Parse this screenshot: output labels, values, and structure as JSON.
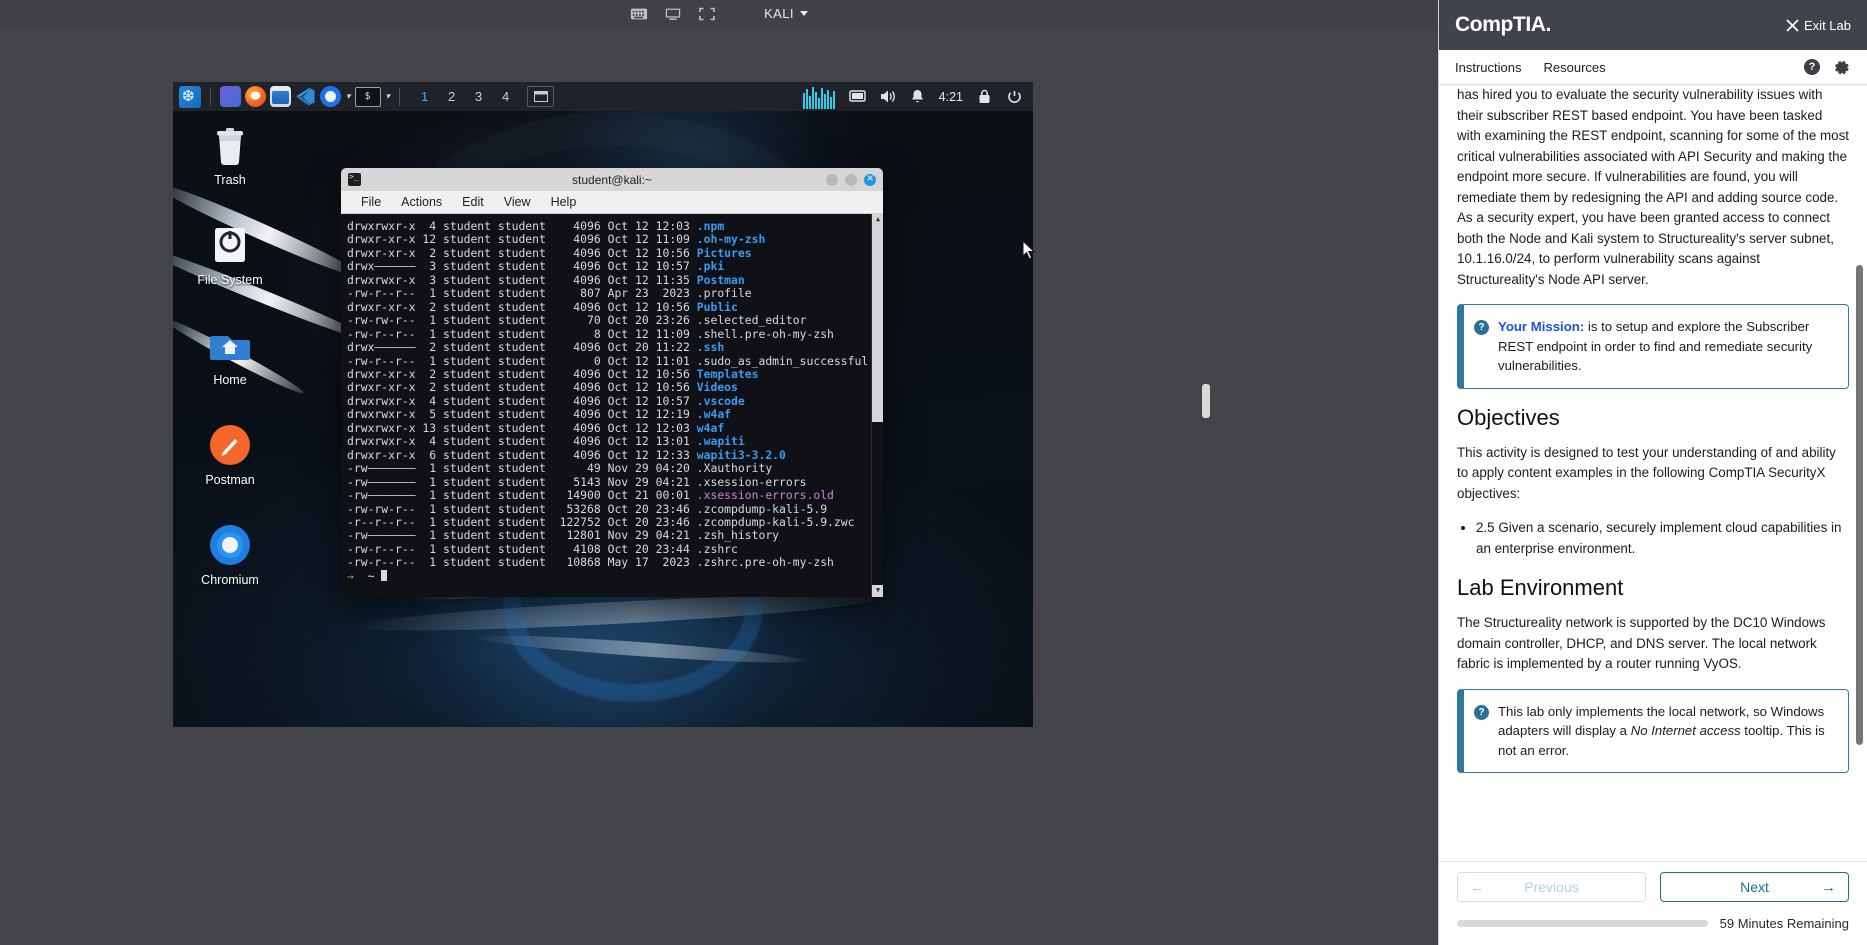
{
  "vm_topbar": {
    "icons": [
      "keyboard-icon",
      "monitor-icon",
      "fullscreen-icon"
    ],
    "vm_name": "KALI"
  },
  "kali_panel": {
    "apps": [
      "kali-menu-icon",
      "terminal-app-icon",
      "firefox-icon",
      "file-manager-icon",
      "vscode-icon",
      "chromium-icon",
      "terminal-launcher-icon"
    ],
    "workspaces": [
      "1",
      "2",
      "3",
      "4"
    ],
    "active_workspace": "1",
    "clock": "4:21",
    "tray": [
      "display-icon",
      "volume-icon",
      "notification-icon",
      "lock-icon",
      "power-icon"
    ]
  },
  "desktop_icons": [
    {
      "name": "Trash",
      "icon": "trash-icon"
    },
    {
      "name": "File System",
      "icon": "drive-icon"
    },
    {
      "name": "Home",
      "icon": "home-folder-icon"
    },
    {
      "name": "Postman",
      "icon": "postman-icon"
    },
    {
      "name": "Chromium",
      "icon": "chromium-icon"
    }
  ],
  "terminal": {
    "title": "student@kali:~",
    "menu": [
      "File",
      "Actions",
      "Edit",
      "View",
      "Help"
    ],
    "window_buttons": [
      "minimize",
      "maximize",
      "close"
    ],
    "lines": [
      {
        "perms": "drwxrwxr-x",
        "links": " 4",
        "owner": "student",
        "group": "student",
        "size": " 4096",
        "date": "Oct 12 12:03",
        "name": ".npm",
        "color": "dir"
      },
      {
        "perms": "drwxr-xr-x",
        "links": "12",
        "owner": "student",
        "group": "student",
        "size": " 4096",
        "date": "Oct 12 11:09",
        "name": ".oh-my-zsh",
        "color": "dir"
      },
      {
        "perms": "drwxr-xr-x",
        "links": " 2",
        "owner": "student",
        "group": "student",
        "size": " 4096",
        "date": "Oct 12 10:56",
        "name": "Pictures",
        "color": "dir"
      },
      {
        "perms": "drwx——————",
        "links": " 3",
        "owner": "student",
        "group": "student",
        "size": " 4096",
        "date": "Oct 12 10:57",
        "name": ".pki",
        "color": "dir"
      },
      {
        "perms": "drwxrwxr-x",
        "links": " 3",
        "owner": "student",
        "group": "student",
        "size": " 4096",
        "date": "Oct 12 11:35",
        "name": "Postman",
        "color": "dir"
      },
      {
        "perms": "-rw-r--r--",
        "links": " 1",
        "owner": "student",
        "group": "student",
        "size": "  807",
        "date": "Apr 23  2023",
        "name": ".profile",
        "color": "plain"
      },
      {
        "perms": "drwxr-xr-x",
        "links": " 2",
        "owner": "student",
        "group": "student",
        "size": " 4096",
        "date": "Oct 12 10:56",
        "name": "Public",
        "color": "dir"
      },
      {
        "perms": "-rw-rw-r--",
        "links": " 1",
        "owner": "student",
        "group": "student",
        "size": "   70",
        "date": "Oct 20 23:26",
        "name": ".selected_editor",
        "color": "plain"
      },
      {
        "perms": "-rw-r--r--",
        "links": " 1",
        "owner": "student",
        "group": "student",
        "size": "    8",
        "date": "Oct 12 11:09",
        "name": ".shell.pre-oh-my-zsh",
        "color": "plain"
      },
      {
        "perms": "drwx——————",
        "links": " 2",
        "owner": "student",
        "group": "student",
        "size": " 4096",
        "date": "Oct 20 11:22",
        "name": ".ssh",
        "color": "dir"
      },
      {
        "perms": "-rw-r--r--",
        "links": " 1",
        "owner": "student",
        "group": "student",
        "size": "    0",
        "date": "Oct 12 11:01",
        "name": ".sudo_as_admin_successful",
        "color": "plain"
      },
      {
        "perms": "drwxr-xr-x",
        "links": " 2",
        "owner": "student",
        "group": "student",
        "size": " 4096",
        "date": "Oct 12 10:56",
        "name": "Templates",
        "color": "dir"
      },
      {
        "perms": "drwxr-xr-x",
        "links": " 2",
        "owner": "student",
        "group": "student",
        "size": " 4096",
        "date": "Oct 12 10:56",
        "name": "Videos",
        "color": "dir"
      },
      {
        "perms": "drwxrwxr-x",
        "links": " 4",
        "owner": "student",
        "group": "student",
        "size": " 4096",
        "date": "Oct 12 10:57",
        "name": ".vscode",
        "color": "dir"
      },
      {
        "perms": "drwxrwxr-x",
        "links": " 5",
        "owner": "student",
        "group": "student",
        "size": " 4096",
        "date": "Oct 12 12:19",
        "name": ".w4af",
        "color": "dir"
      },
      {
        "perms": "drwxrwxr-x",
        "links": "13",
        "owner": "student",
        "group": "student",
        "size": " 4096",
        "date": "Oct 12 12:03",
        "name": "w4af",
        "color": "dir"
      },
      {
        "perms": "drwxrwxr-x",
        "links": " 4",
        "owner": "student",
        "group": "student",
        "size": " 4096",
        "date": "Oct 12 13:01",
        "name": ".wapiti",
        "color": "dir"
      },
      {
        "perms": "drwxr-xr-x",
        "links": " 6",
        "owner": "student",
        "group": "student",
        "size": " 4096",
        "date": "Oct 12 12:33",
        "name": "wapiti3-3.2.0",
        "color": "dir"
      },
      {
        "perms": "-rw———————",
        "links": " 1",
        "owner": "student",
        "group": "student",
        "size": "   49",
        "date": "Nov 29 04:20",
        "name": ".Xauthority",
        "color": "plain"
      },
      {
        "perms": "-rw———————",
        "links": " 1",
        "owner": "student",
        "group": "student",
        "size": " 5143",
        "date": "Nov 29 04:21",
        "name": ".xsession-errors",
        "color": "plain"
      },
      {
        "perms": "-rw———————",
        "links": " 1",
        "owner": "student",
        "group": "student",
        "size": "14900",
        "date": "Oct 21 00:01",
        "name": ".xsession-errors.old",
        "color": "media"
      },
      {
        "perms": "-rw-rw-r--",
        "links": " 1",
        "owner": "student",
        "group": "student",
        "size": "53268",
        "date": "Oct 20 23:46",
        "name": ".zcompdump-kali-5.9",
        "color": "plain"
      },
      {
        "perms": "-r--r--r--",
        "links": " 1",
        "owner": "student",
        "group": "student",
        "size": "122752",
        "date": "Oct 20 23:46",
        "name": ".zcompdump-kali-5.9.zwc",
        "color": "plain"
      },
      {
        "perms": "-rw———————",
        "links": " 1",
        "owner": "student",
        "group": "student",
        "size": "12801",
        "date": "Nov 29 04:21",
        "name": ".zsh_history",
        "color": "plain"
      },
      {
        "perms": "-rw-r--r--",
        "links": " 1",
        "owner": "student",
        "group": "student",
        "size": " 4108",
        "date": "Oct 20 23:44",
        "name": ".zshrc",
        "color": "plain"
      },
      {
        "perms": "-rw-r--r--",
        "links": " 1",
        "owner": "student",
        "group": "student",
        "size": "10868",
        "date": "May 17  2023",
        "name": ".zshrc.pre-oh-my-zsh",
        "color": "plain"
      }
    ],
    "prompt_symbol": "→",
    "prompt_path": "~"
  },
  "sidebar": {
    "brand": "CompTIA.",
    "exit_label": "Exit Lab",
    "tabs": [
      {
        "label": "Instructions",
        "active": true
      },
      {
        "label": "Resources",
        "active": false
      }
    ],
    "header_icons": [
      "help-icon",
      "settings-gear-icon"
    ],
    "intro_paragraph": "has hired you to evaluate the security vulnerability issues with their subscriber REST based endpoint. You have been tasked with examining the REST endpoint, scanning for some of the most critical vulnerabilities associated with API Security and making the endpoint more secure. If vulnerabilities are found, you will remediate them by redesigning the API and adding source code. As a security expert, you have been granted access to connect both the Node and Kali system to Structureality's server subnet, 10.1.16.0/24, to perform vulnerability scans against Structureality's Node API server.",
    "mission_callout": {
      "label": "Your Mission:",
      "text": " is to setup and explore the Subscriber REST endpoint in order to find and remediate security vulnerabilities."
    },
    "objectives": {
      "heading": "Objectives",
      "paragraph": "This activity is designed to test your understanding of and ability to apply content examples in the following CompTIA SecurityX objectives:",
      "items": [
        "2.5 Given a scenario, securely implement cloud capabilities in an enterprise environment."
      ]
    },
    "lab_environment": {
      "heading": "Lab Environment",
      "paragraph": "The Structureality network is supported by the DC10 Windows domain controller, DHCP, and DNS server. The local network fabric is implemented by a router running VyOS.",
      "callout_text_1": "This lab only implements the local network, so Windows adapters will display a ",
      "callout_italic": "No Internet access",
      "callout_text_2": " tooltip. This is not an error."
    },
    "footer": {
      "previous_label": "Previous",
      "next_label": "Next",
      "time_remaining": "59 Minutes Remaining"
    }
  },
  "colors": {
    "brand_dark": "#40444a",
    "accent_blue": "#1f6f95",
    "mission_blue": "#1f4fe0",
    "terminal_bg": "#0f1116",
    "dir_blue": "#3a9bf0"
  }
}
